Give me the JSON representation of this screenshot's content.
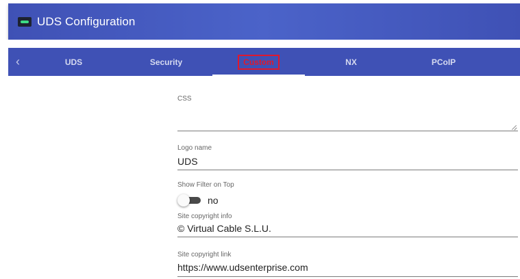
{
  "app": {
    "title": "UDS Configuration",
    "icon": "toggle-app-icon"
  },
  "tabs": {
    "prev_icon": "chevron-left-icon",
    "items": [
      {
        "label": "UDS",
        "active": false
      },
      {
        "label": "Security",
        "active": false
      },
      {
        "label": "Custom",
        "active": true,
        "highlighted": true
      },
      {
        "label": "NX",
        "active": false
      },
      {
        "label": "PCoIP",
        "active": false
      }
    ]
  },
  "form": {
    "css": {
      "label": "CSS",
      "value": ""
    },
    "logo_name": {
      "label": "Logo name",
      "value": "UDS"
    },
    "show_filter": {
      "label": "Show Filter on Top",
      "state_text": "no",
      "checked": false
    },
    "site_copyright_info": {
      "label": "Site copyright info",
      "value": "© Virtual Cable S.L.U."
    },
    "site_copyright_link": {
      "label": "Site copyright link",
      "value": "https://www.udsenterprise.com"
    }
  },
  "colors": {
    "primary": "#3f51b5",
    "highlight_border": "#e0182d"
  }
}
